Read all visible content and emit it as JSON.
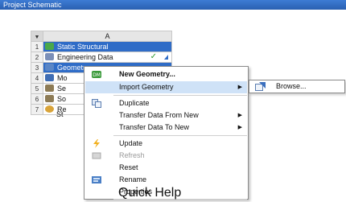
{
  "window": {
    "title": "Project Schematic"
  },
  "system": {
    "column_header": "A",
    "rows": [
      {
        "num": "1",
        "label": "Static Structural",
        "icon": "static-structural-icon",
        "color": "#4aa84a"
      },
      {
        "num": "2",
        "label": "Engineering Data",
        "icon": "engineering-data-icon",
        "color": "#7b8fb8",
        "status": "✓"
      },
      {
        "num": "3",
        "label": "Geometry",
        "icon": "geometry-icon",
        "color": "#5a86c6"
      },
      {
        "num": "4",
        "label": "Mo",
        "icon": "model-icon",
        "color": "#3f6db4"
      },
      {
        "num": "5",
        "label": "Se",
        "icon": "setup-icon",
        "color": "#8d7b55"
      },
      {
        "num": "6",
        "label": "So",
        "icon": "solution-icon",
        "color": "#8d7b55"
      },
      {
        "num": "7",
        "label": "Re",
        "icon": "results-icon",
        "color": "#d9a43a"
      }
    ],
    "below_label": "St"
  },
  "context_menu": {
    "items": {
      "new_geometry": "New Geometry...",
      "import_geometry": "Import Geometry",
      "duplicate": "Duplicate",
      "transfer_from_new": "Transfer Data From New",
      "transfer_to_new": "Transfer Data To New",
      "update": "Update",
      "refresh": "Refresh",
      "reset": "Reset",
      "rename": "Rename",
      "properties": "Properties",
      "quick_help": "Quick Help"
    },
    "submenu_arrow": "▶"
  },
  "submenu": {
    "browse": "Browse..."
  },
  "colors": {
    "titlebar": "#2a5fb0",
    "selection": "#2f6cc7",
    "menu_highlight": "#cfe2f7"
  }
}
